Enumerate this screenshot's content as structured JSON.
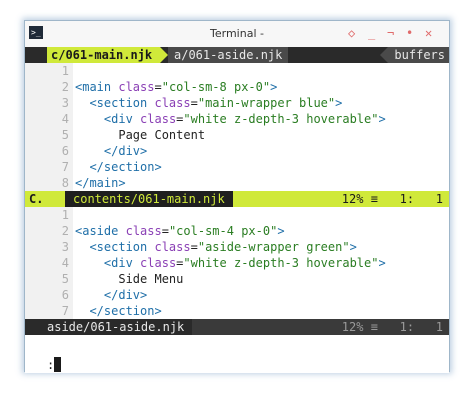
{
  "window": {
    "title": "Terminal -",
    "controls": [
      "◇",
      "_",
      "¬",
      "•",
      "✕"
    ]
  },
  "tabline": {
    "active_tab": "c/061-main.njk",
    "inactive_tab": "a/061-aside.njk",
    "buffers_label": "buffers"
  },
  "top_pane": {
    "lines": [
      {
        "n": "1",
        "code": ""
      },
      {
        "n": "2",
        "code": "<main class=\"col-sm-8 px-0\">"
      },
      {
        "n": "3",
        "code": "  <section class=\"main-wrapper blue\">"
      },
      {
        "n": "4",
        "code": "    <div class=\"white z-depth-3 hoverable\">"
      },
      {
        "n": "5",
        "code": "      Page Content"
      },
      {
        "n": "6",
        "code": "    </div>"
      },
      {
        "n": "7",
        "code": "  </section>"
      },
      {
        "n": "8",
        "code": "</main>"
      }
    ],
    "status": {
      "mode": "C.",
      "file": "contents/061-main.njk",
      "percent": "12%",
      "equiv": "≡",
      "line": "1:",
      "col": "1"
    }
  },
  "bottom_pane": {
    "lines": [
      {
        "n": "1",
        "code": ""
      },
      {
        "n": "2",
        "code": "<aside class=\"col-sm-4 px-0\">"
      },
      {
        "n": "3",
        "code": "  <section class=\"aside-wrapper green\">"
      },
      {
        "n": "4",
        "code": "    <div class=\"white z-depth-3 hoverable\">"
      },
      {
        "n": "5",
        "code": "      Side Menu"
      },
      {
        "n": "6",
        "code": "    </div>"
      },
      {
        "n": "7",
        "code": "  </section>"
      }
    ],
    "status": {
      "file": "aside/061-aside.njk",
      "percent": "12%",
      "equiv": "≡",
      "line": "1:",
      "col": "1"
    }
  },
  "cmdline": {
    "text": ":"
  },
  "colors": {
    "accent": "#d0e93a",
    "tabline_bg": "#2a2a2a",
    "tag": "#1f6fa8",
    "attr": "#8a3fb5",
    "string": "#2a7d22"
  }
}
